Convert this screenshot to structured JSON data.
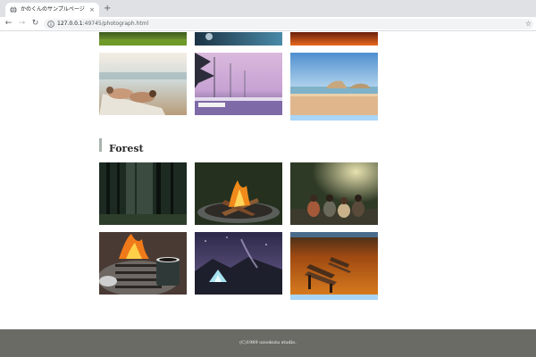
{
  "browser": {
    "tab_title": "かのくんのサンプルページ",
    "close_glyph": "×",
    "new_tab_glyph": "+",
    "back_glyph": "←",
    "forward_glyph": "→",
    "reload_glyph": "↻",
    "url_host": "127.0.0.1",
    "url_path": ":49745/photograph.html",
    "star_glyph": "☆"
  },
  "gallery": {
    "section_title": "Forest",
    "highlight_color": "#a9d6f7",
    "top_partial_row": [
      {
        "icon": "grass-photo-icon"
      },
      {
        "icon": "dark-water-photo-icon"
      },
      {
        "icon": "sunset-photo-icon"
      }
    ],
    "beach_row": [
      {
        "icon": "beach-lounge-photo-icon"
      },
      {
        "icon": "marina-photo-icon"
      },
      {
        "icon": "sandy-beach-photo-icon"
      }
    ],
    "forest_row_1": [
      {
        "icon": "dark-forest-photo-icon"
      },
      {
        "icon": "campfire-photo-icon"
      },
      {
        "icon": "friends-camping-photo-icon"
      }
    ],
    "forest_row_2": [
      {
        "icon": "coffee-grill-photo-icon"
      },
      {
        "icon": "night-tent-photo-icon"
      },
      {
        "icon": "autumn-bench-photo-icon"
      }
    ]
  },
  "footer": {
    "copyright": "(C)1989 ozookuta studio."
  }
}
